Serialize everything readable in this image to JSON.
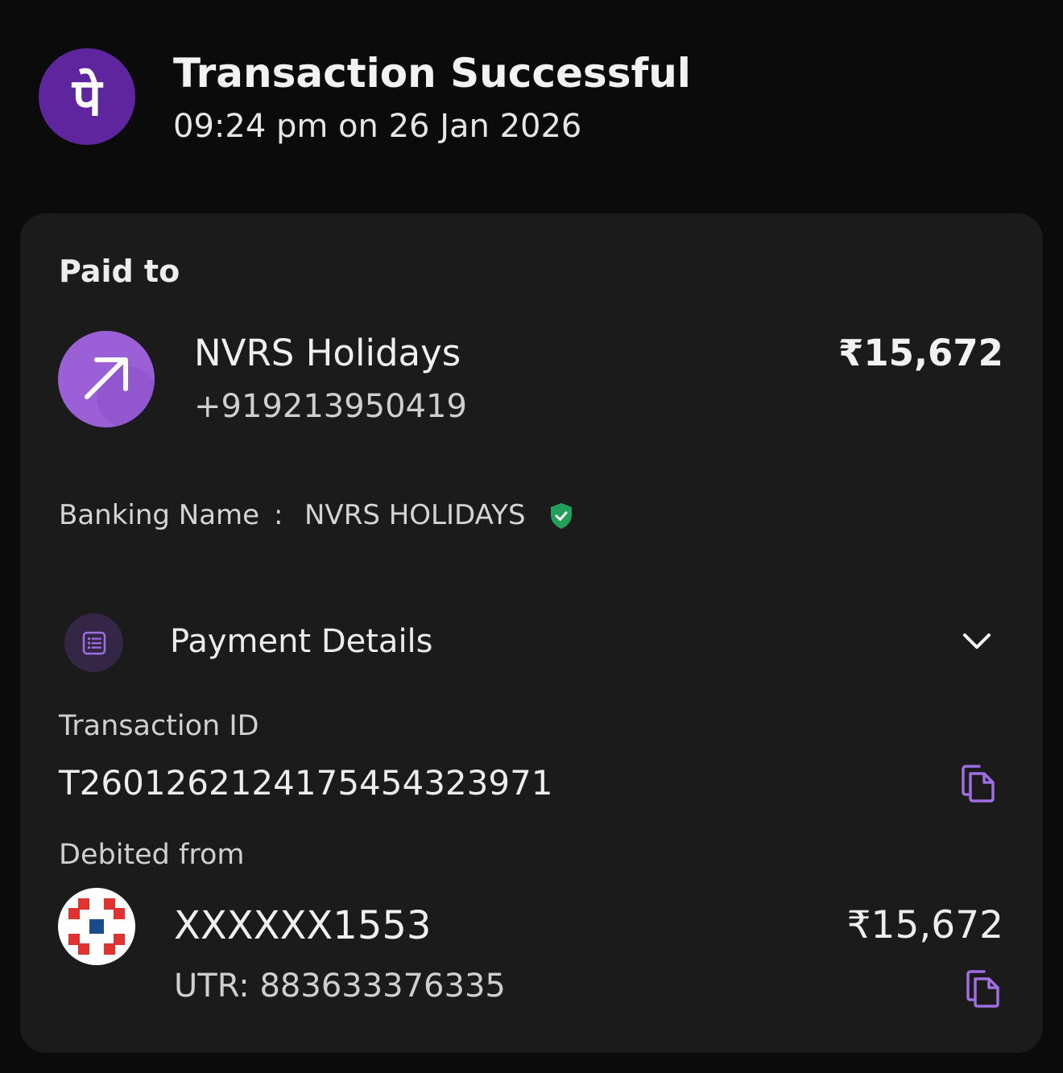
{
  "header": {
    "logo_glyph": "पे",
    "title": "Transaction Successful",
    "timestamp": "09:24 pm on 26 Jan 2026"
  },
  "paid_to": {
    "label": "Paid to",
    "name": "NVRS Holidays",
    "phone": "+919213950419",
    "amount": "₹15,672",
    "banking_name_label": "Banking Name",
    "banking_name_separator": ":",
    "banking_name_value": "NVRS HOLIDAYS"
  },
  "payment_details": {
    "label": "Payment Details",
    "transaction_id_label": "Transaction ID",
    "transaction_id": "T2601262124175454323971",
    "debited_from_label": "Debited from",
    "account": "XXXXXX1553",
    "utr": "UTR: 883633376335",
    "amount": "₹15,672"
  },
  "icons": {
    "app_logo": "phonepe-logo",
    "payee_avatar": "arrow-up-right-icon",
    "verified": "shield-check-icon",
    "details": "list-icon",
    "expand": "chevron-down-icon",
    "copy": "copy-icon",
    "bank_logo": "bank-logo"
  },
  "colors": {
    "brand_purple": "#5f259f",
    "avatar_purple": "#9b5fd6",
    "accent_purple": "#9d6ee0",
    "verified_green": "#22a05b",
    "bank_red": "#e0332f",
    "bank_blue": "#184a8c",
    "background": "#0b0b0c",
    "card": "#1b1b1c"
  }
}
